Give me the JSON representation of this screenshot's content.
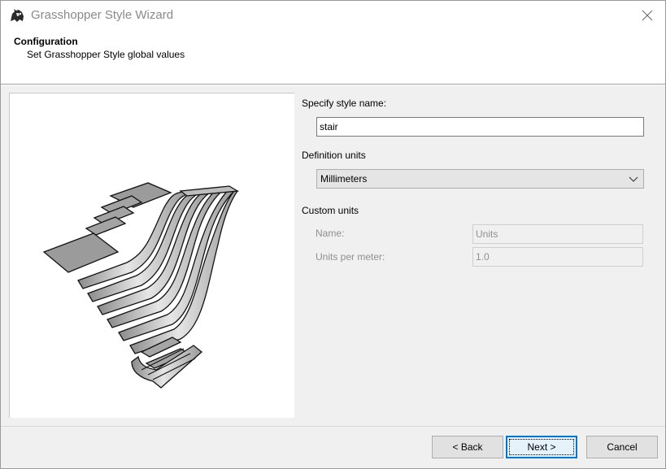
{
  "window": {
    "title": "Grasshopper Style Wizard",
    "app_icon": "rhino-icon",
    "close_icon": "close-icon"
  },
  "header": {
    "title": "Configuration",
    "subtitle": "Set Grasshopper Style global values"
  },
  "preview": {
    "description_icon": "stair-preview-image"
  },
  "form": {
    "style_name_label": "Specify style name:",
    "style_name_value": "stair",
    "definition_units_label": "Definition units",
    "definition_units_value": "Millimeters",
    "custom_units_label": "Custom units",
    "name_label": "Name:",
    "name_value": "Units",
    "units_per_meter_label": "Units per meter:",
    "units_per_meter_value": "1.0"
  },
  "buttons": {
    "back": "< Back",
    "next": "Next >",
    "cancel": "Cancel"
  },
  "colors": {
    "accent": "#0078d7",
    "panel": "#f0f0f0"
  }
}
